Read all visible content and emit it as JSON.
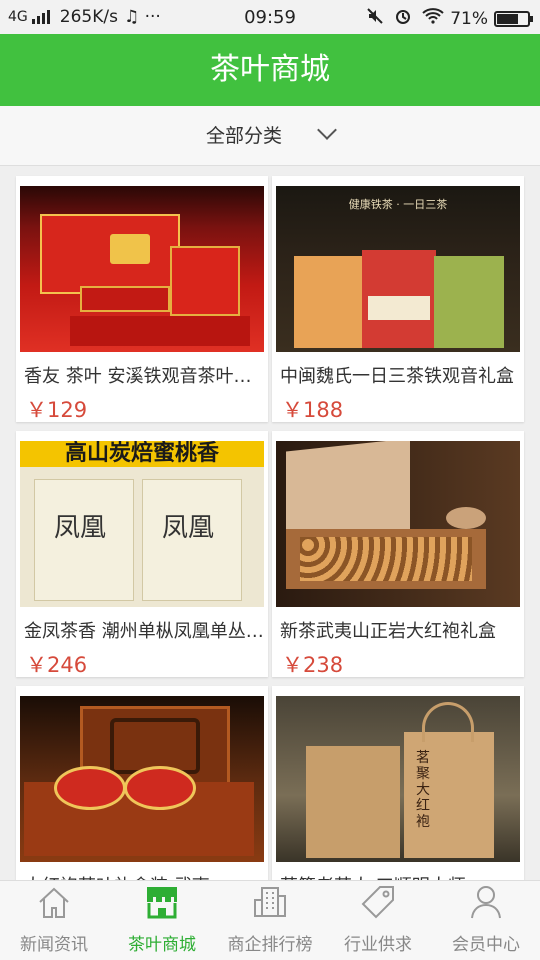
{
  "status_bar": {
    "network": "4G",
    "speed": "265K/s",
    "extra": "♫ ···",
    "time": "09:59",
    "battery": "71%",
    "battery_level": 0.71
  },
  "header": {
    "title": "茶叶商城"
  },
  "filter": {
    "label": "全部分类"
  },
  "products": [
    {
      "title": "香友 茶叶 安溪铁观音茶叶礼盒装",
      "price": "￥129"
    },
    {
      "title": "中闽魏氏一日三茶铁观音礼盒",
      "price": "￥188"
    },
    {
      "title": "金凤茶香 潮州单枞凤凰单丛蜜桃香",
      "price": "￥246"
    },
    {
      "title": "新茶武夷山正岩大红袍礼盒",
      "price": "￥238"
    },
    {
      "title": "大红袍茶叶礼盒装 武夷",
      "price": ""
    },
    {
      "title": "茗签老茶人 工顺明大师",
      "price": ""
    }
  ],
  "images": {
    "p2_banner": "健康铁茶 · 一日三茶",
    "p3_banner": "高山炭焙蜜桃香",
    "p3_box_text": "凤凰",
    "p6_bag_text": "茗聚大红袍"
  },
  "nav": [
    {
      "label": "新闻资讯",
      "icon": "home-icon"
    },
    {
      "label": "茶叶商城",
      "icon": "store-icon"
    },
    {
      "label": "商企排行榜",
      "icon": "building-icon"
    },
    {
      "label": "行业供求",
      "icon": "tag-icon"
    },
    {
      "label": "会员中心",
      "icon": "user-icon"
    }
  ],
  "colors": {
    "brand": "#41c13f",
    "nav_active": "#2eae34",
    "price": "#d64a3b"
  }
}
